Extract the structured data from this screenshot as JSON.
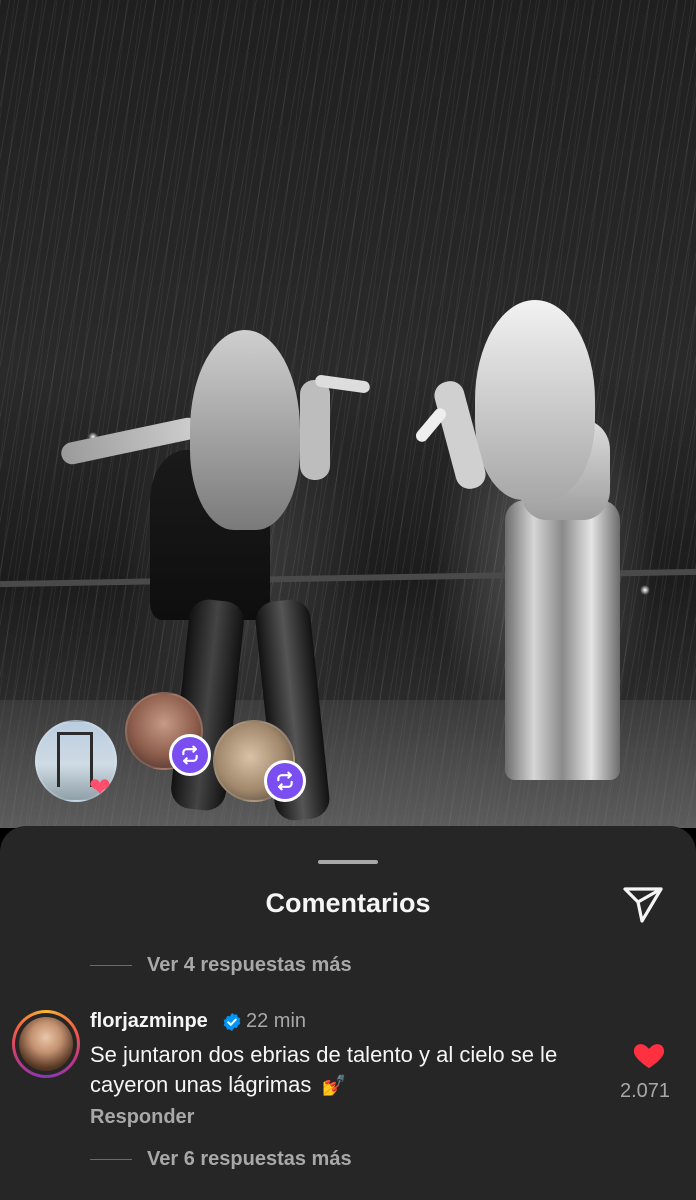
{
  "sheet": {
    "title": "Comentarios",
    "share_icon": "paper-plane-icon"
  },
  "replies_above": {
    "label": "Ver 4 respuestas más"
  },
  "comment": {
    "username": "florjazminpe",
    "verified": true,
    "time": "22 min",
    "text": "Se juntaron dos ebrias de talento y al cielo se le cayeron unas lágrimas",
    "emoji": "💅",
    "reply_label": "Responder",
    "like_count": "2.071",
    "like_icon": "heart-filled-icon"
  },
  "replies_below": {
    "label": "Ver 6 respuestas más"
  },
  "reactions": {
    "icons": [
      "heart-icon",
      "repost-icon",
      "repost-icon"
    ]
  },
  "colors": {
    "sheet_bg": "#262626",
    "text_primary": "#f5f5f5",
    "text_secondary": "#a8a8a8",
    "like_red": "#ff3040",
    "verified_blue": "#0095f6",
    "repost_badge": "#7a4ef0"
  }
}
